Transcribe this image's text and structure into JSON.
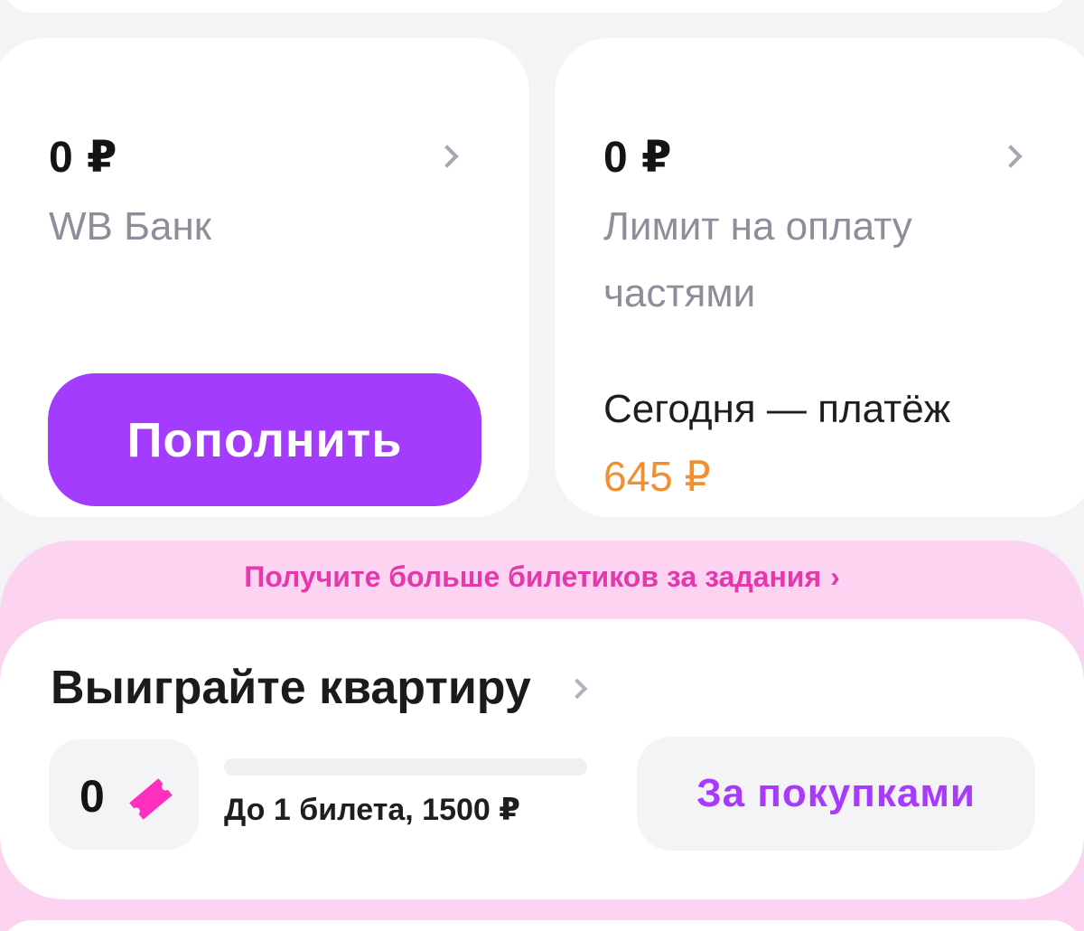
{
  "accounts": {
    "bank": {
      "amount": "0 ₽",
      "name": "WB Банк",
      "button_label": "Пополнить"
    },
    "installments": {
      "amount": "0 ₽",
      "name": "Лимит на оплату частями",
      "payment_label": "Сегодня — платёж",
      "payment_amount": "645 ₽"
    }
  },
  "promo": {
    "link_text": "Получите больше билетиков за задания",
    "arrow": "›"
  },
  "lottery": {
    "title": "Выиграйте квартиру",
    "tickets_count": "0",
    "progress_fraction": 0,
    "progress_text": "До 1 билета, 1500 ₽",
    "shop_button": "За покупками"
  },
  "colors": {
    "accent_purple": "#a33cfd",
    "payment_orange": "#f18f35",
    "promo_pink": "#e23aab",
    "promo_bg": "#fcd3f1",
    "ticket_pink": "#ff2fbf"
  },
  "icons": {
    "chevron": "chevron-right-icon",
    "ticket": "ticket-icon"
  }
}
